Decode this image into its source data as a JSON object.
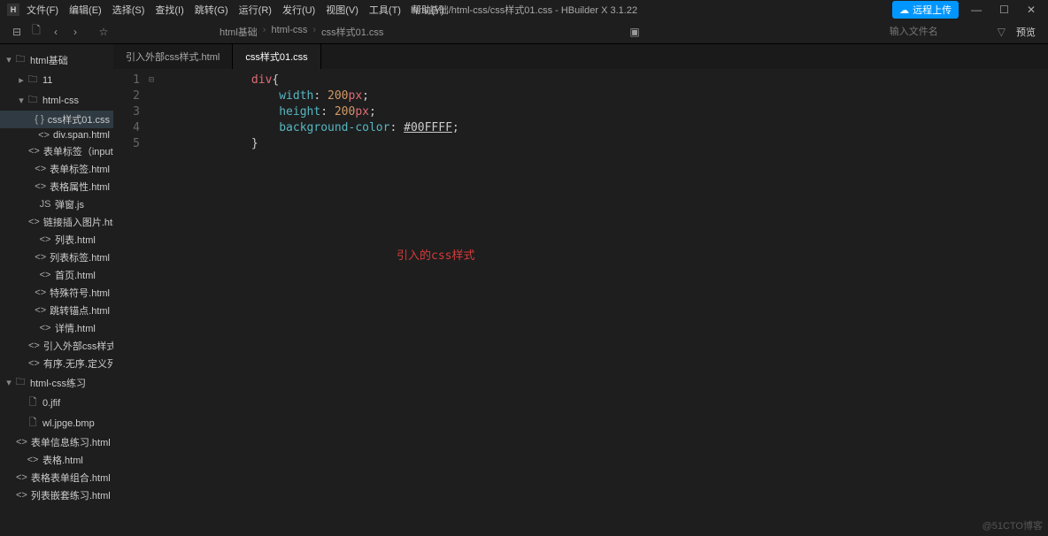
{
  "title": "html基础/html-css/css样式01.css - HBuilder X 3.1.22",
  "menu": [
    "文件(F)",
    "编辑(E)",
    "选择(S)",
    "查找(I)",
    "跳转(G)",
    "运行(R)",
    "发行(U)",
    "视图(V)",
    "工具(T)",
    "帮助(Y)"
  ],
  "upload_button": "远程上传",
  "breadcrumb": [
    "html基础",
    "html-css",
    "css样式01.css"
  ],
  "filter_placeholder": "输入文件名",
  "preview_label": "预览",
  "tabs": [
    {
      "label": "引入外部css样式.html",
      "active": false
    },
    {
      "label": "css样式01.css",
      "active": true
    }
  ],
  "sidebar": [
    {
      "depth": 0,
      "chev": "▾",
      "icon": "folder",
      "label": "html基础"
    },
    {
      "depth": 1,
      "chev": "▸",
      "icon": "folder",
      "label": "11"
    },
    {
      "depth": 1,
      "chev": "▾",
      "icon": "folder",
      "label": "html-css"
    },
    {
      "depth": 2,
      "icon": "css",
      "label": "css样式01.css",
      "active": true
    },
    {
      "depth": 2,
      "icon": "code",
      "label": "div.span.html"
    },
    {
      "depth": 2,
      "icon": "code",
      "label": "表单标签（input..."
    },
    {
      "depth": 2,
      "icon": "code",
      "label": "表单标签.html"
    },
    {
      "depth": 2,
      "icon": "code",
      "label": "表格属性.html"
    },
    {
      "depth": 2,
      "icon": "js",
      "label": "弹窗.js"
    },
    {
      "depth": 2,
      "icon": "code",
      "label": "链接插入图片.html"
    },
    {
      "depth": 2,
      "icon": "code",
      "label": "列表.html"
    },
    {
      "depth": 2,
      "icon": "code",
      "label": "列表标签.html"
    },
    {
      "depth": 2,
      "icon": "code",
      "label": "首页.html"
    },
    {
      "depth": 2,
      "icon": "code",
      "label": "特殊符号.html"
    },
    {
      "depth": 2,
      "icon": "code",
      "label": "跳转锚点.html"
    },
    {
      "depth": 2,
      "icon": "code",
      "label": "详情.html"
    },
    {
      "depth": 2,
      "icon": "code",
      "label": "引入外部css样式...."
    },
    {
      "depth": 2,
      "icon": "code",
      "label": "有序.无序.定义列..."
    },
    {
      "depth": 0,
      "chev": "▾",
      "icon": "folder",
      "label": "html-css练习"
    },
    {
      "depth": 1,
      "icon": "file",
      "label": "0.jfif"
    },
    {
      "depth": 1,
      "icon": "file",
      "label": "wl.jpge.bmp"
    },
    {
      "depth": 1,
      "icon": "code",
      "label": "表单信息练习.html"
    },
    {
      "depth": 1,
      "icon": "code",
      "label": "表格.html"
    },
    {
      "depth": 1,
      "icon": "code",
      "label": "表格表单组合.html"
    },
    {
      "depth": 1,
      "icon": "code",
      "label": "列表嵌套练习.html"
    }
  ],
  "code": {
    "lines": [
      {
        "n": 1,
        "tokens": [
          [
            "selector",
            "div"
          ],
          [
            "punct",
            "{"
          ]
        ]
      },
      {
        "n": 2,
        "tokens": [
          [
            "indent",
            "    "
          ],
          [
            "prop",
            "width"
          ],
          [
            "punct",
            ": "
          ],
          [
            "number",
            "200"
          ],
          [
            "unit",
            "px"
          ],
          [
            "punct",
            ";"
          ]
        ]
      },
      {
        "n": 3,
        "tokens": [
          [
            "indent",
            "    "
          ],
          [
            "prop",
            "height"
          ],
          [
            "punct",
            ": "
          ],
          [
            "number",
            "200"
          ],
          [
            "unit",
            "px"
          ],
          [
            "punct",
            ";"
          ]
        ]
      },
      {
        "n": 4,
        "tokens": [
          [
            "indent",
            "    "
          ],
          [
            "prop",
            "background-color"
          ],
          [
            "punct",
            ": "
          ],
          [
            "hex",
            "#00FFFF"
          ],
          [
            "punct",
            ";"
          ]
        ]
      },
      {
        "n": 5,
        "tokens": [
          [
            "punct",
            "}"
          ]
        ]
      }
    ]
  },
  "overlay": "引入的css样式",
  "watermark": "@51CTO博客",
  "icon_text": {
    "folder": "🗀",
    "code": "<>",
    "css": "{ }",
    "js": "JS",
    "file": "🗋"
  }
}
